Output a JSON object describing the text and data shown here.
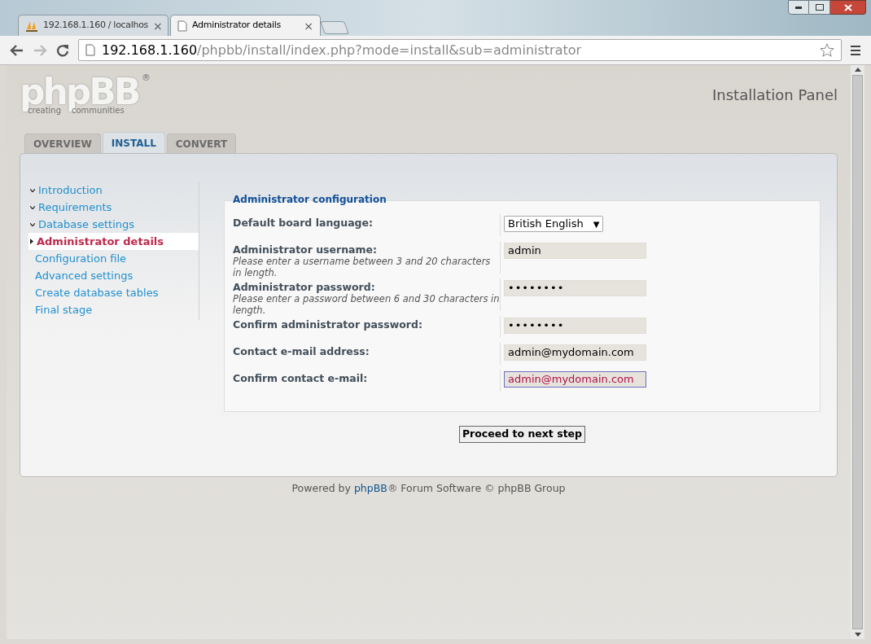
{
  "browser": {
    "tabs": [
      {
        "title": "192.168.1.160 / localhos",
        "kind": "pma",
        "selected": false,
        "close": "×"
      },
      {
        "title": "Administrator details",
        "kind": "page",
        "selected": true,
        "close": "×"
      }
    ],
    "url_host": "192.168.1.160",
    "url_path": "/phpbb/install/index.php?mode=install&sub=administrator"
  },
  "header": {
    "logo_title": "phpBB",
    "logo_mark": "®",
    "logo_tagline_1": "creating",
    "logo_tagline_2": "communities",
    "panel_title": "Installation Panel"
  },
  "tabs": [
    {
      "label": "OVERVIEW",
      "selected": false
    },
    {
      "label": "INSTALL",
      "selected": true
    },
    {
      "label": "CONVERT",
      "selected": false
    }
  ],
  "menu": [
    {
      "label": "Introduction",
      "done": true,
      "selected": false
    },
    {
      "label": "Requirements",
      "done": true,
      "selected": false
    },
    {
      "label": "Database settings",
      "done": true,
      "selected": false
    },
    {
      "label": "Administrator details",
      "done": false,
      "selected": true
    },
    {
      "label": "Configuration file",
      "done": false,
      "selected": false
    },
    {
      "label": "Advanced settings",
      "done": false,
      "selected": false
    },
    {
      "label": "Create database tables",
      "done": false,
      "selected": false
    },
    {
      "label": "Final stage",
      "done": false,
      "selected": false
    }
  ],
  "form": {
    "legend": "Administrator configuration",
    "fields": [
      {
        "label": "Default board language:",
        "kind": "select",
        "value": "British English",
        "arrow": "▼"
      },
      {
        "label": "Administrator username:",
        "hint": "Please enter a username between 3 and 20 characters in length.",
        "kind": "text",
        "value": "admin",
        "focused": false
      },
      {
        "label": "Administrator password:",
        "hint": "Please enter a password between 6 and 30 characters in length.",
        "kind": "password",
        "value": "••••••••",
        "focused": false
      },
      {
        "label": "Confirm administrator password:",
        "kind": "password",
        "value": "••••••••",
        "focused": false
      },
      {
        "label": "Contact e-mail address:",
        "kind": "text",
        "value": "admin@mydomain.com",
        "focused": false
      },
      {
        "label": "Confirm contact e-mail:",
        "kind": "text",
        "value": "admin@mydomain.com",
        "focused": true
      }
    ]
  },
  "submit": "Proceed to next step",
  "footer": {
    "before": "Powered by",
    "link": "phpBB",
    "after": "® Forum Software © phpBB Group"
  }
}
